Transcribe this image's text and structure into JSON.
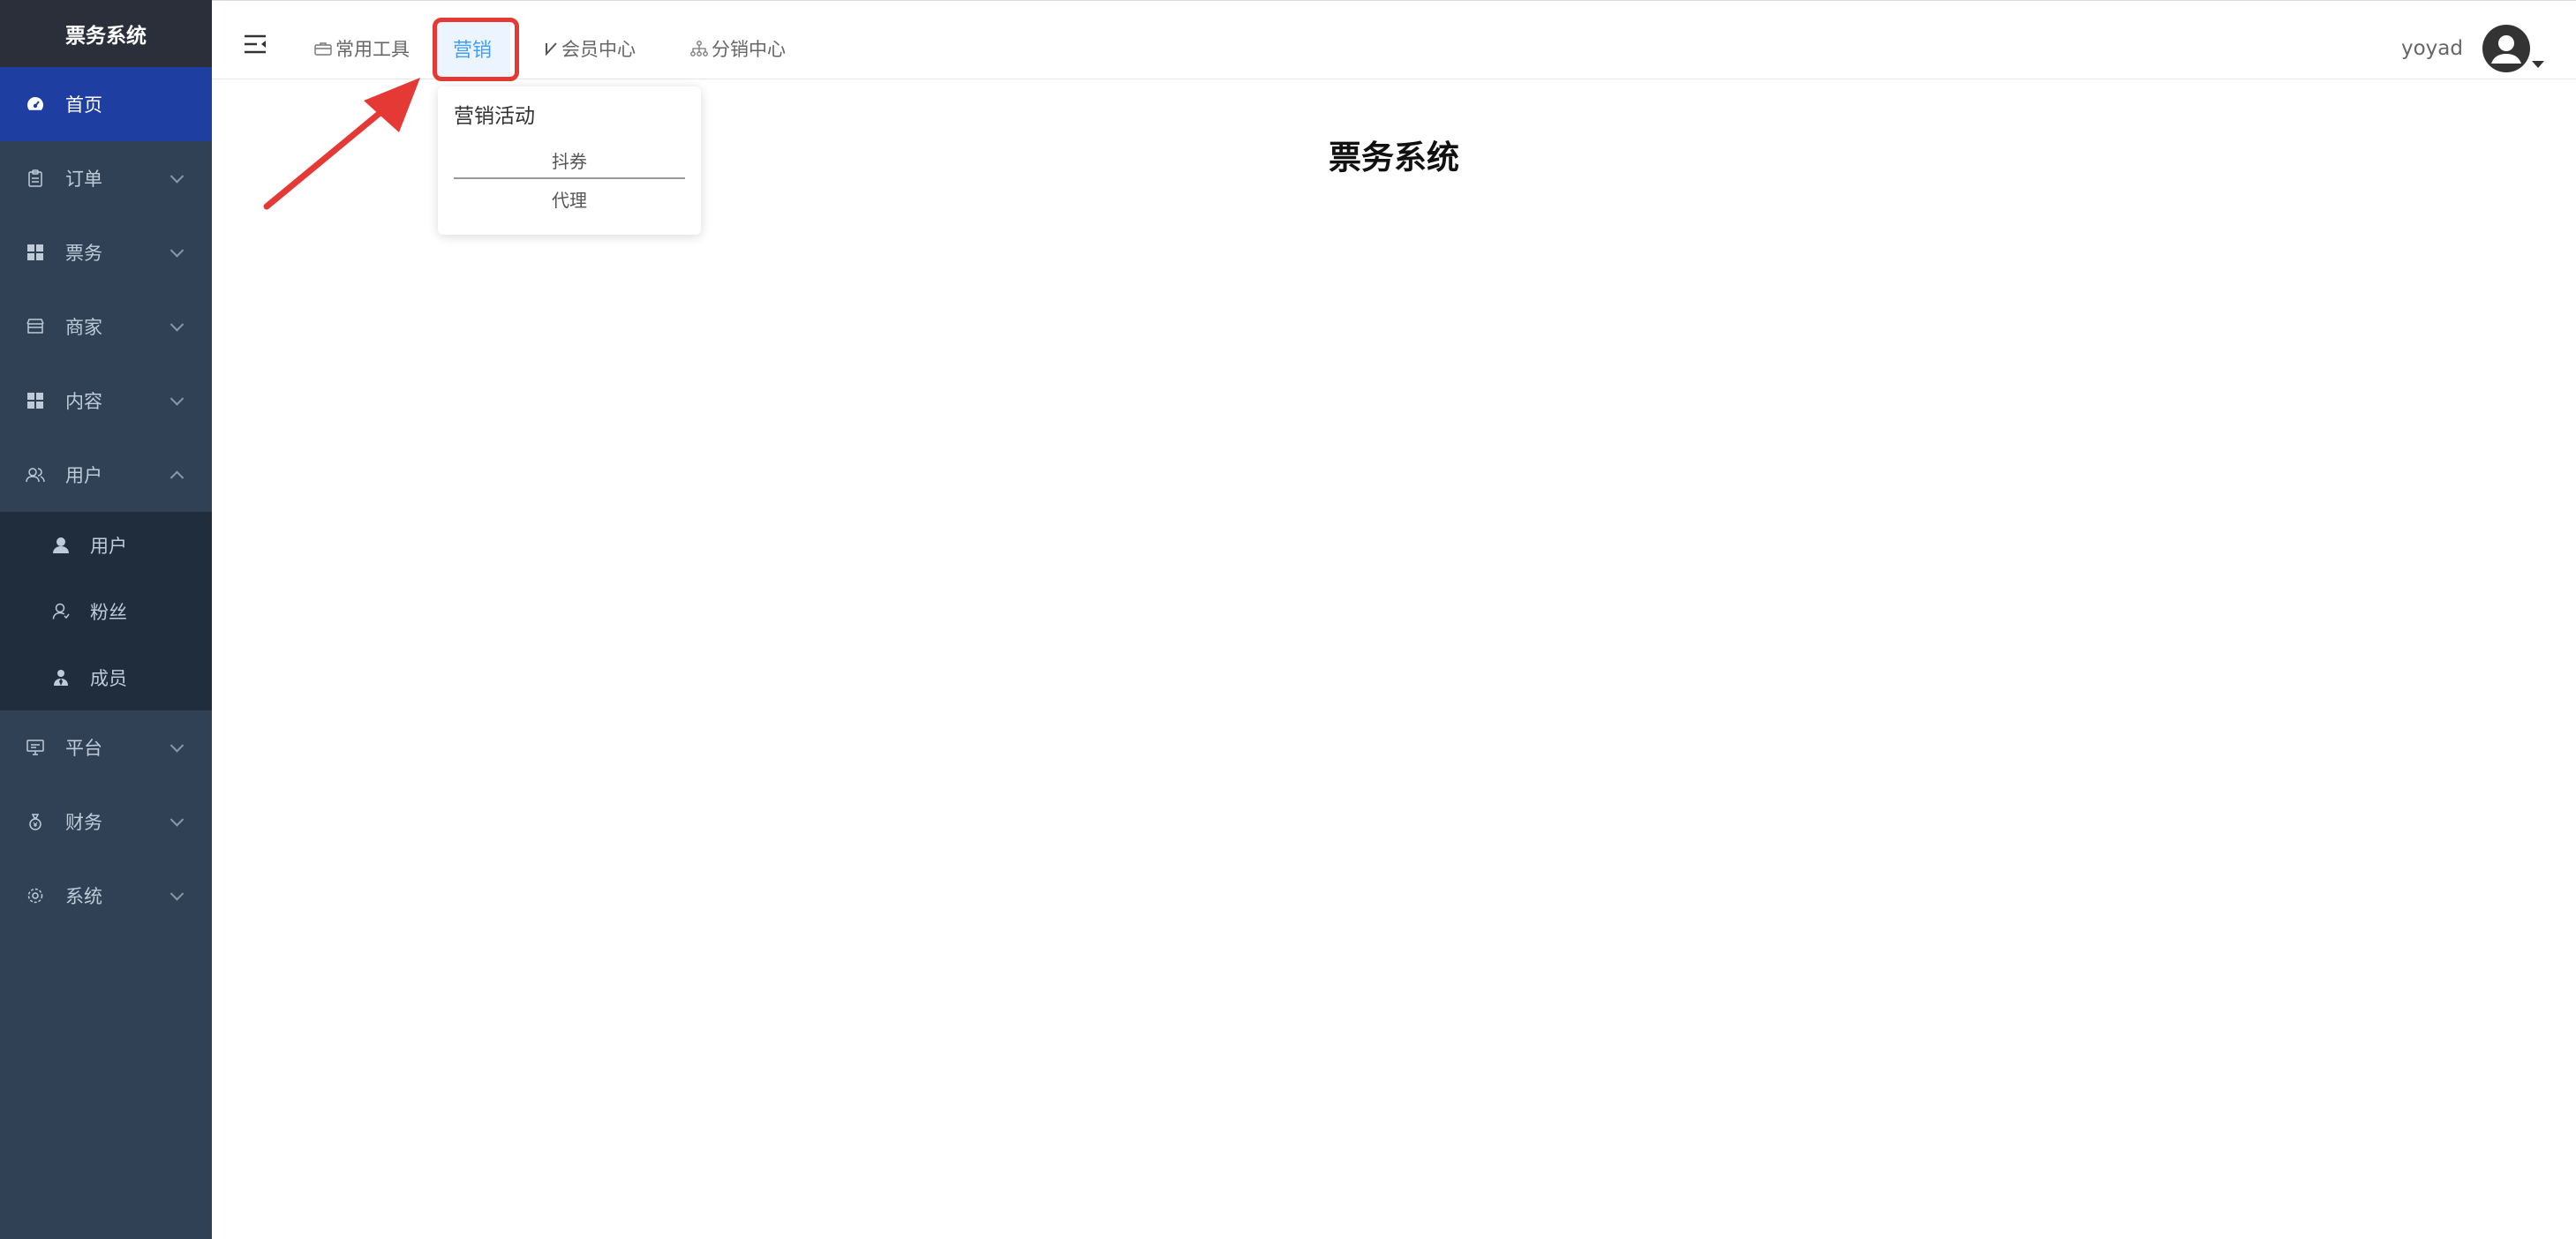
{
  "sidebar": {
    "brand": "票务系统",
    "items": [
      {
        "label": "首页",
        "icon": "dashboard-icon",
        "active": true
      },
      {
        "label": "订单",
        "icon": "clipboard-icon",
        "expanded": false
      },
      {
        "label": "票务",
        "icon": "grid-icon",
        "expanded": false
      },
      {
        "label": "商家",
        "icon": "shop-icon",
        "expanded": false
      },
      {
        "label": "内容",
        "icon": "grid-icon",
        "expanded": false
      },
      {
        "label": "用户",
        "icon": "users-icon",
        "expanded": true
      },
      {
        "label": "平台",
        "icon": "monitor-icon",
        "expanded": false
      },
      {
        "label": "财务",
        "icon": "money-bag-icon",
        "expanded": false
      },
      {
        "label": "系统",
        "icon": "gear-icon",
        "expanded": false
      }
    ],
    "user_submenu": [
      {
        "label": "用户",
        "icon": "person-icon"
      },
      {
        "label": "粉丝",
        "icon": "person-outline-icon"
      },
      {
        "label": "成员",
        "icon": "member-icon"
      }
    ]
  },
  "navbar": {
    "tabs": [
      {
        "label": "常用工具",
        "icon": "toolbox-icon"
      },
      {
        "label": "营销",
        "icon": "",
        "active": true
      },
      {
        "label": "会员中心",
        "icon": "check-icon"
      },
      {
        "label": "分销中心",
        "icon": "org-tree-icon"
      }
    ],
    "username": "yoyad"
  },
  "dropdown": {
    "title": "营销活动",
    "items": [
      "抖券",
      "代理"
    ]
  },
  "main": {
    "title": "票务系统"
  },
  "colors": {
    "sidebar_bg": "#304156",
    "sidebar_active": "#1e3fa1",
    "submenu_bg": "#1f2d3d",
    "tab_active": "#409eff",
    "highlight": "#e53935"
  }
}
